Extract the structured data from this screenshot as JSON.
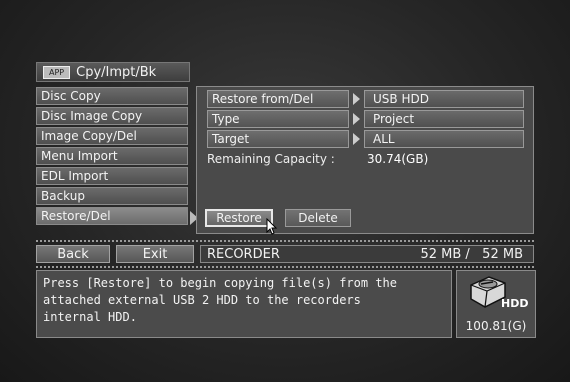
{
  "header": {
    "badge": "APP",
    "title": "Cpy/Impt/Bk"
  },
  "menu": {
    "items": [
      {
        "label": "Disc Copy"
      },
      {
        "label": "Disc Image Copy"
      },
      {
        "label": "Image Copy/Del"
      },
      {
        "label": "Menu Import"
      },
      {
        "label": "EDL Import"
      },
      {
        "label": "Backup"
      },
      {
        "label": "Restore/Del",
        "active": true
      }
    ]
  },
  "settings": {
    "restore_from": {
      "label": "Restore from/Del",
      "value": "USB HDD"
    },
    "type": {
      "label": "Type",
      "value": "Project"
    },
    "target": {
      "label": "Target",
      "value": "ALL"
    },
    "remaining": {
      "label": "Remaining Capacity",
      "value": "30.74(GB)"
    }
  },
  "actions": {
    "restore_label": "Restore",
    "delete_label": "Delete"
  },
  "bottom": {
    "back_label": "Back",
    "exit_label": "Exit",
    "status_device": "RECORDER",
    "status_size": "52 MB /   52 MB"
  },
  "message": {
    "lines": [
      "Press [Restore] to begin copying file(s) from the",
      "attached external USB 2 HDD to the recorders",
      "internal HDD."
    ]
  },
  "hdd": {
    "label": "HDD",
    "capacity": "100.81(G)",
    "icon": "hdd-icon"
  }
}
